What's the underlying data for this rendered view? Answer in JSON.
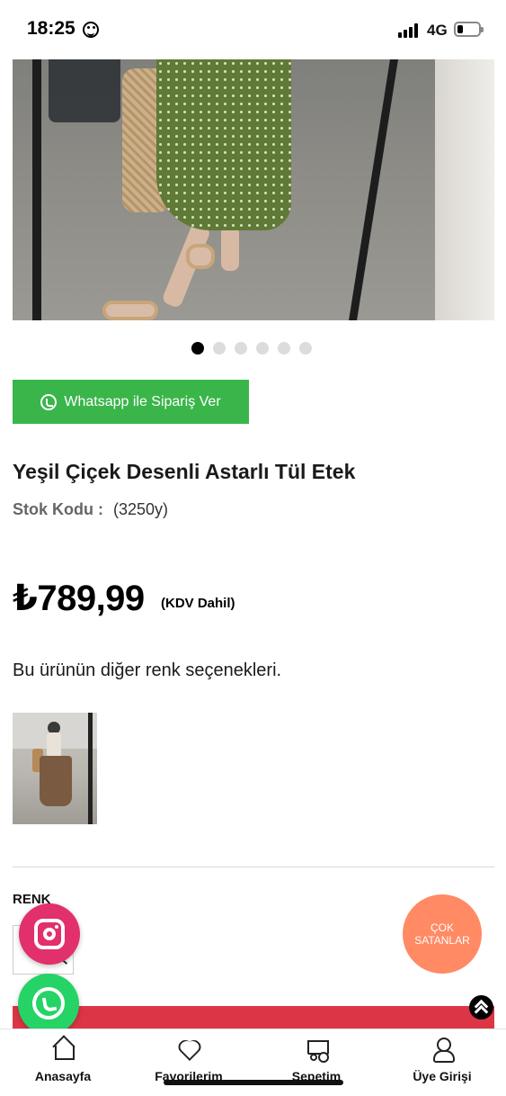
{
  "status_bar": {
    "time": "18:25",
    "network": "4G"
  },
  "product": {
    "title": "Yeşil Çiçek Desenli Astarlı Tül Etek",
    "stock_label": "Stok Kodu :",
    "stock_code": "(3250y)",
    "price": "₺789,99",
    "vat_note": "(KDV Dahil)",
    "image_count": 6,
    "active_image": 1
  },
  "whatsapp_order": {
    "label": "Whatsapp ile Sipariş Ver"
  },
  "other_colors": {
    "heading": "Bu ürünün diğer renk seçenekleri."
  },
  "color_section": {
    "label": "RENK"
  },
  "best_sellers": {
    "label": "ÇOK SATANLAR"
  },
  "bottom_nav": {
    "items": [
      {
        "label": "Anasayfa",
        "icon": "home-icon"
      },
      {
        "label": "Favorilerim",
        "icon": "heart-icon"
      },
      {
        "label": "Sepetim",
        "icon": "cart-icon"
      },
      {
        "label": "Üye Girişi",
        "icon": "user-icon"
      }
    ]
  },
  "colors": {
    "whatsapp_green": "#3ab54a",
    "floating_whatsapp": "#25d366",
    "instagram": "#e1306c",
    "best_sellers": "#ff8a64",
    "cart_bar": "#dc3545"
  }
}
